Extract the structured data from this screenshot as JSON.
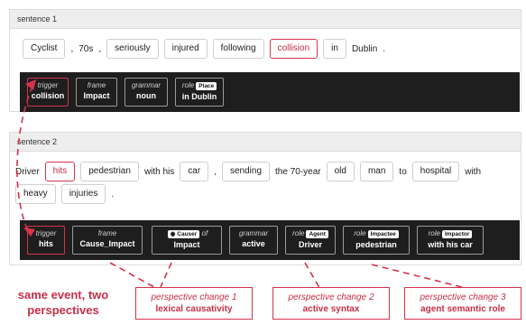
{
  "sentence1": {
    "header": "sentence 1",
    "tokens": [
      {
        "text": "Cyclist",
        "boxed": true
      },
      {
        "text": ",",
        "boxed": false
      },
      {
        "text": "70s",
        "boxed": false
      },
      {
        "text": ",",
        "boxed": false
      },
      {
        "text": "seriously",
        "boxed": true
      },
      {
        "text": "injured",
        "boxed": true
      },
      {
        "text": "following",
        "boxed": true
      },
      {
        "text": "collision",
        "boxed": true,
        "highlight": true
      },
      {
        "text": "in",
        "boxed": true
      },
      {
        "text": "Dublin",
        "boxed": false
      },
      {
        "text": ".",
        "boxed": false
      }
    ],
    "cards": [
      {
        "label": "trigger",
        "value": "collision"
      },
      {
        "label": "frame",
        "value": "Impact"
      },
      {
        "label": "grammar",
        "value": "noun"
      },
      {
        "label": "role",
        "badge": "Place",
        "value": "in Dublin"
      }
    ]
  },
  "sentence2": {
    "header": "sentence 2",
    "line1": [
      {
        "text": "Driver",
        "boxed": false
      },
      {
        "text": "hits",
        "boxed": true,
        "highlight": true
      },
      {
        "text": "pedestrian",
        "boxed": true
      },
      {
        "text": "with his",
        "boxed": false
      },
      {
        "text": "car",
        "boxed": true
      },
      {
        "text": ",",
        "boxed": false
      },
      {
        "text": "sending",
        "boxed": true
      },
      {
        "text": "the 70-year",
        "boxed": false
      },
      {
        "text": "old",
        "boxed": true
      },
      {
        "text": "man",
        "boxed": true
      },
      {
        "text": "to",
        "boxed": false
      },
      {
        "text": "hospital",
        "boxed": true
      },
      {
        "text": "with",
        "boxed": false
      }
    ],
    "line2": [
      {
        "text": "heavy",
        "boxed": true
      },
      {
        "text": "injuries",
        "boxed": true
      },
      {
        "text": ".",
        "boxed": false
      }
    ],
    "cards": [
      {
        "label": "trigger",
        "value": "hits"
      },
      {
        "label": "frame",
        "value": "Cause_Impact"
      },
      {
        "label": "of",
        "badge": "Causer",
        "value": "Impact"
      },
      {
        "label": "grammar",
        "value": "active"
      },
      {
        "label": "role",
        "badge": "Agent",
        "value": "Driver"
      },
      {
        "label": "role",
        "badge": "Impactee",
        "value": "pedestrian"
      },
      {
        "label": "role",
        "badge": "Impactor",
        "value": "with his car"
      }
    ]
  },
  "notes": {
    "main": "same event, two perspectives",
    "change1": {
      "title": "perspective change 1",
      "desc": "lexical causativity"
    },
    "change2": {
      "title": "perspective change 2",
      "desc": "active syntax"
    },
    "change3": {
      "title": "perspective change 3",
      "desc": "agent semantic role"
    }
  },
  "colors": {
    "accent": "#d6334b",
    "bar": "#1e1e1e"
  }
}
